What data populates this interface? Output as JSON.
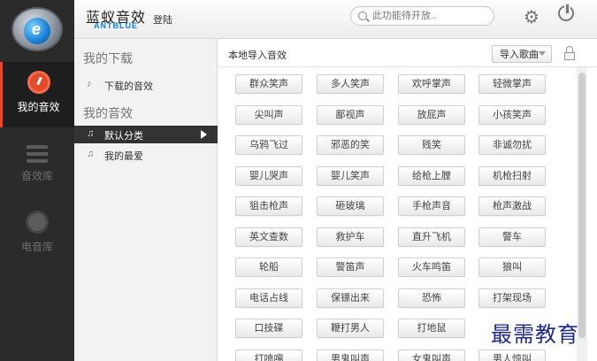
{
  "app": {
    "name": "蓝蚁音效",
    "sub": "ANTBLUE",
    "login": "登陆"
  },
  "search": {
    "placeholder": "此功能待开放.."
  },
  "rail": {
    "items": [
      {
        "label": "我的音效",
        "icon": "gauge-icon",
        "active": true
      },
      {
        "label": "音效库",
        "icon": "list-icon"
      },
      {
        "label": "电音库",
        "icon": "atom-icon"
      }
    ]
  },
  "nav": {
    "downloads_header": "我的下载",
    "downloaded_item": "下载的音效",
    "effects_header": "我的音效",
    "default_category": "默认分类",
    "favorites": "我的最爱"
  },
  "main": {
    "title": "本地导入音效",
    "import_button": "导入歌曲"
  },
  "sounds": [
    "群众笑声",
    "多人笑声",
    "欢呼掌声",
    "轻微掌声",
    "尖叫声",
    "鄙视声",
    "放屁声",
    "小孩笑声",
    "乌鸦飞过",
    "邪恶的笑",
    "贱笑",
    "非诚勿扰",
    "婴儿哭声",
    "婴儿笑声",
    "给枪上膛",
    "机枪扫射",
    "狙击枪声",
    "砸玻璃",
    "手枪声音",
    "枪声激战",
    "英文查数",
    "救护车",
    "直升飞机",
    "警车",
    "轮船",
    "警笛声",
    "火车鸣笛",
    "狼叫",
    "电话占线",
    "保镖出来",
    "恐怖",
    "打架现场",
    "口技碟",
    "鞭打男人",
    "打地鼠",
    "",
    "打喷嚏",
    "男鬼叫声",
    "女鬼叫声",
    "男人惊叫"
  ],
  "watermark": "最需教育",
  "colors": {
    "accent": "#e14b2a",
    "rail_bg": "#2b2b2b",
    "brand_blue": "#1a7fd2"
  }
}
